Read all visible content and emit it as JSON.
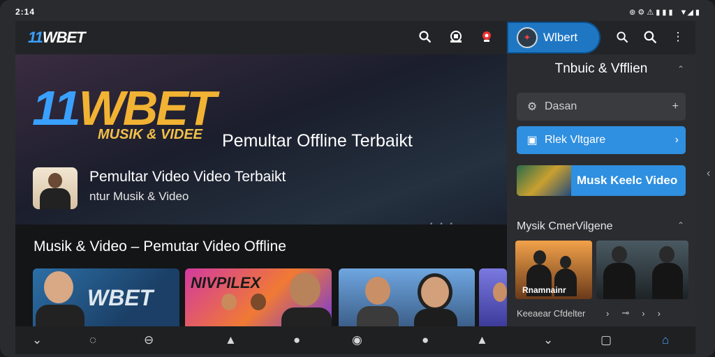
{
  "status": {
    "time": "2:14",
    "left_icons": "✕ ⊙",
    "right_icons": "⊛ ⚙ ⚠ ▮ ▮ ▮",
    "signal": "▼◢ ▮"
  },
  "main": {
    "brand": {
      "prefix": "11",
      "suffix": "WBET"
    },
    "topbar_icons": [
      "search-icon",
      "profile-icon",
      "flag-icon"
    ],
    "hero": {
      "big_prefix": "11",
      "big_suffix": "WBET",
      "big_subtitle": "MUSIK & VIDEE",
      "title": "Pemultar Offline Terbaikt",
      "app_title": "Pemultar Video Video Terbaikt",
      "app_subtitle": "ntur Musik & Video"
    },
    "section_title": "Musik & Video – Pemutar Video Offline",
    "cards": [
      {
        "text": "WBET"
      },
      {
        "text": "NIVPILEX"
      },
      {
        "text": ""
      },
      {
        "text": ""
      }
    ]
  },
  "side": {
    "account_label": "Wlbert",
    "header": "Tnbuic & Vfflien",
    "rows": [
      {
        "label": "Dasan",
        "end": "+"
      },
      {
        "label": "Rlek Vltgare",
        "end": "›"
      },
      {
        "label": "Musk Keelc Video",
        "end": ""
      }
    ],
    "section": "Mysik CmerVilgene",
    "cards": [
      {
        "caption": "Rnamnainr"
      },
      {
        "caption": ""
      }
    ],
    "footer": "Keeaear Cfdelter"
  },
  "colors": {
    "accent": "#2f8fe0",
    "brand_blue": "#3aa0ff",
    "brand_gold": "#f2b233"
  }
}
